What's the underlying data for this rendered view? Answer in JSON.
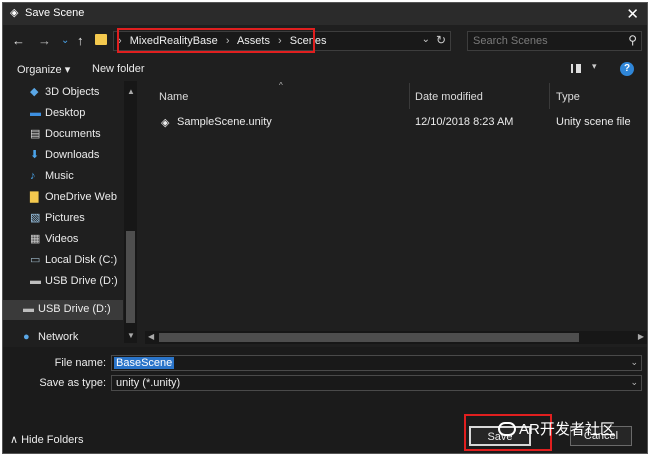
{
  "window": {
    "title": "Save Scene",
    "close_glyph": "✕"
  },
  "nav": {
    "back": "←",
    "forward": "→",
    "recent": "⌄",
    "up": "↑"
  },
  "breadcrumb": [
    "MixedRealityBase",
    "Assets",
    "Scenes"
  ],
  "address": {
    "separator": "›",
    "dropdown": "⌄",
    "refresh": "↻"
  },
  "search": {
    "placeholder": "Search Scenes",
    "icon": "search-icon"
  },
  "toolbar": {
    "organize": "Organize ▾",
    "new_folder": "New folder",
    "help": "?"
  },
  "sidebar": {
    "items": [
      {
        "label": "3D Objects",
        "icon": "cube-icon",
        "glyph": "◆",
        "color": "#5aa7e6"
      },
      {
        "label": "Desktop",
        "icon": "desktop-icon",
        "glyph": "▬",
        "color": "#3d8fe0"
      },
      {
        "label": "Documents",
        "icon": "document-icon",
        "glyph": "▤",
        "color": "#d8d8d8"
      },
      {
        "label": "Downloads",
        "icon": "download-icon",
        "glyph": "⬇",
        "color": "#4aa3ea"
      },
      {
        "label": "Music",
        "icon": "music-icon",
        "glyph": "♪",
        "color": "#4aa3ea"
      },
      {
        "label": "OneDrive Web",
        "icon": "folder-icon",
        "glyph": "▇",
        "color": "#f4c94e"
      },
      {
        "label": "Pictures",
        "icon": "picture-icon",
        "glyph": "▧",
        "color": "#9ec9ea"
      },
      {
        "label": "Videos",
        "icon": "video-icon",
        "glyph": "▦",
        "color": "#cfcfcf"
      },
      {
        "label": "Local Disk (C:)",
        "icon": "disk-icon",
        "glyph": "▭",
        "color": "#9fb8c8"
      },
      {
        "label": "USB Drive (D:)",
        "icon": "usb-drive-icon",
        "glyph": "▬",
        "color": "#bdbdbd"
      },
      {
        "label": "USB Drive (D:)",
        "icon": "usb-drive-icon",
        "glyph": "▬",
        "color": "#bdbdbd"
      },
      {
        "label": "Network",
        "icon": "network-icon",
        "glyph": "●",
        "color": "#5aa7e6"
      }
    ]
  },
  "columns": {
    "name": "Name",
    "date": "Date modified",
    "type": "Type",
    "sort_indicator": "^"
  },
  "files": [
    {
      "name": "SampleScene.unity",
      "date": "12/10/2018 8:23 AM",
      "type": "Unity scene file",
      "icon": "unity-icon"
    }
  ],
  "form": {
    "file_name_label": "File name:",
    "file_name_value": "BaseScene",
    "save_type_label": "Save as type:",
    "save_type_value": "unity (*.unity)"
  },
  "footer": {
    "hide_folders": "Hide Folders",
    "save": "Save",
    "cancel": "Cancel"
  },
  "watermark": "AR开发者社区",
  "colors": {
    "accent": "#2a74c9",
    "highlight_box": "#e01f1f",
    "background": "#1f1f1f"
  }
}
